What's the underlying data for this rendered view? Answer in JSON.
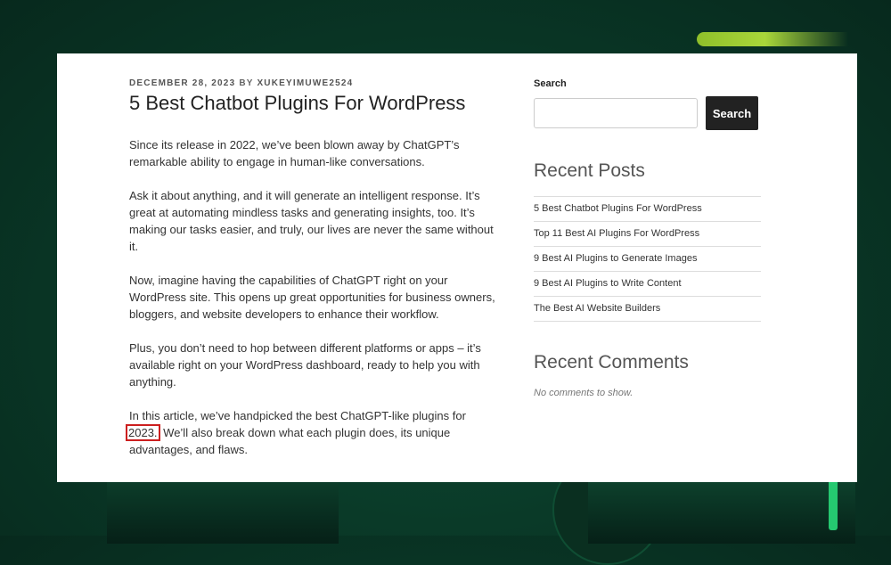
{
  "article": {
    "date": "DECEMBER 28, 2023",
    "by_label": "BY",
    "author": "XUKEYIMUWE2524",
    "title": "5 Best Chatbot Plugins For WordPress",
    "paragraphs": [
      "Since its release in 2022, we’ve been blown away by ChatGPT’s remarkable ability to engage in human-like conversations.",
      "Ask it about anything, and it will generate an intelligent response. It’s great at automating mindless tasks and generating insights, too. It’s making our tasks easier, and truly, our lives are never the same without it.",
      "Now, imagine having the capabilities of ChatGPT right on your WordPress site. This opens up great opportunities for business owners, bloggers, and website developers to enhance their workflow.",
      "Plus, you don’t need to hop between different platforms or apps – it’s available right on your WordPress dashboard, ready to help you with anything."
    ],
    "last_paragraph": {
      "before": "In this article, we’ve handpicked the best ChatGPT-like plugins for",
      "highlight": "2023.",
      "after": " We’ll also break down what each plugin does, its unique advantages, and flaws."
    }
  },
  "sidebar": {
    "search_label": "Search",
    "search_value": "",
    "search_button": "Search",
    "recent_posts_title": "Recent Posts",
    "recent_posts": [
      "5 Best Chatbot Plugins For WordPress",
      "Top 11 Best AI Plugins For WordPress",
      "9 Best AI Plugins to Generate Images",
      "9 Best AI Plugins to Write Content",
      "The Best AI Website Builders"
    ],
    "recent_comments_title": "Recent Comments",
    "no_comments": "No comments to show."
  },
  "colors": {
    "background": "#0a3a28",
    "accent_stripe": "#a9d63a",
    "highlight_box": "#cc1f1f",
    "button": "#222222"
  }
}
